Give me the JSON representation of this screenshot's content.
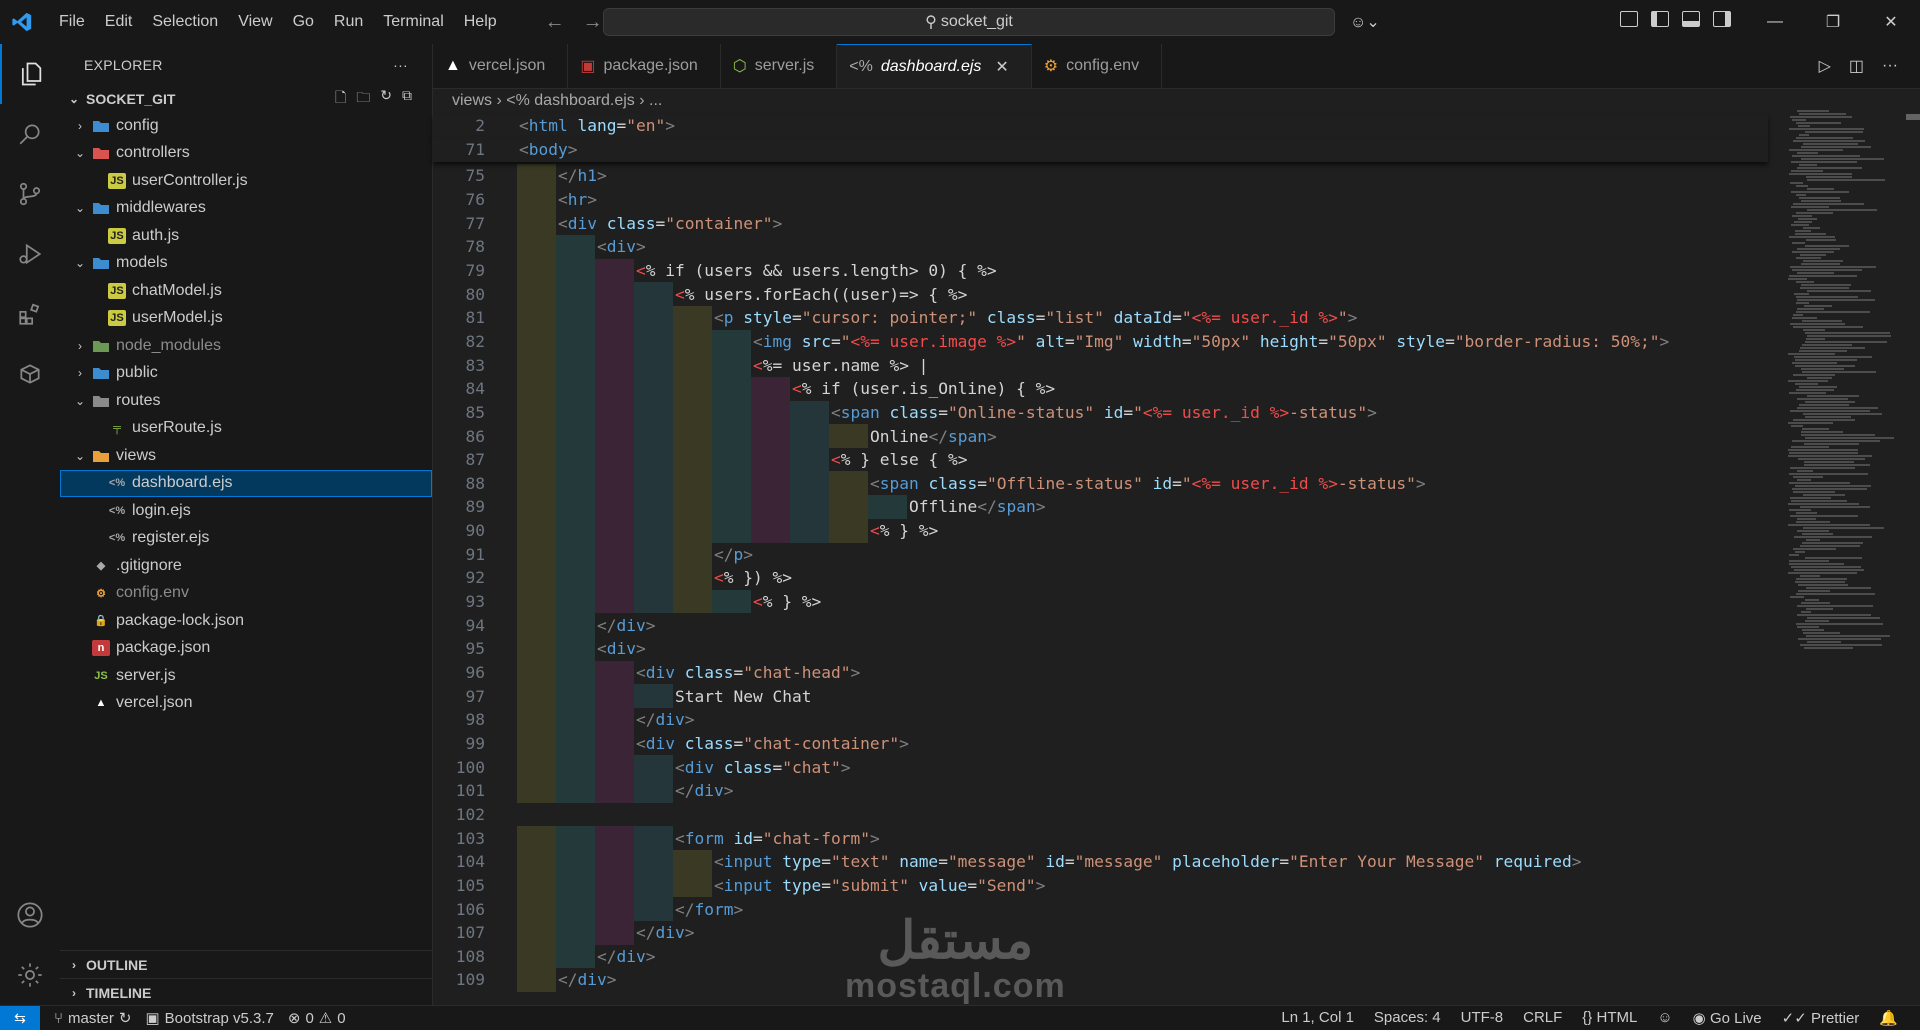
{
  "titlebar": {
    "menu": [
      "File",
      "Edit",
      "Selection",
      "View",
      "Go",
      "Run",
      "Terminal",
      "Help"
    ],
    "search_text": "socket_git"
  },
  "sidebar": {
    "title": "EXPLORER",
    "folder": "SOCKET_GIT",
    "tree": [
      {
        "label": "config",
        "kind": "folder",
        "depth": 1,
        "open": false
      },
      {
        "label": "controllers",
        "kind": "folder",
        "depth": 1,
        "open": true
      },
      {
        "label": "userController.js",
        "kind": "js",
        "depth": 2
      },
      {
        "label": "middlewares",
        "kind": "folder",
        "depth": 1,
        "open": true
      },
      {
        "label": "auth.js",
        "kind": "js",
        "depth": 2
      },
      {
        "label": "models",
        "kind": "folder",
        "depth": 1,
        "open": true
      },
      {
        "label": "chatModel.js",
        "kind": "js",
        "depth": 2
      },
      {
        "label": "userModel.js",
        "kind": "js",
        "depth": 2
      },
      {
        "label": "node_modules",
        "kind": "folder",
        "depth": 1,
        "open": false,
        "dim": true
      },
      {
        "label": "public",
        "kind": "folder",
        "depth": 1,
        "open": false
      },
      {
        "label": "routes",
        "kind": "folder",
        "depth": 1,
        "open": true
      },
      {
        "label": "userRoute.js",
        "kind": "route",
        "depth": 2
      },
      {
        "label": "views",
        "kind": "folder",
        "depth": 1,
        "open": true
      },
      {
        "label": "dashboard.ejs",
        "kind": "ejs",
        "depth": 2,
        "selected": true
      },
      {
        "label": "login.ejs",
        "kind": "ejs",
        "depth": 2
      },
      {
        "label": "register.ejs",
        "kind": "ejs",
        "depth": 2
      },
      {
        "label": ".gitignore",
        "kind": "git",
        "depth": 1
      },
      {
        "label": "config.env",
        "kind": "env",
        "depth": 1,
        "dim": true
      },
      {
        "label": "package-lock.json",
        "kind": "lock",
        "depth": 1
      },
      {
        "label": "package.json",
        "kind": "npm",
        "depth": 1
      },
      {
        "label": "server.js",
        "kind": "node",
        "depth": 1
      },
      {
        "label": "vercel.json",
        "kind": "vercel",
        "depth": 1
      }
    ],
    "outline": "OUTLINE",
    "timeline": "TIMELINE"
  },
  "tabs": [
    {
      "label": "vercel.json",
      "icon": "vercel-icon"
    },
    {
      "label": "package.json",
      "icon": "npm-icon"
    },
    {
      "label": "server.js",
      "icon": "node-icon"
    },
    {
      "label": "dashboard.ejs",
      "icon": "ejs-icon",
      "active": true
    },
    {
      "label": "config.env",
      "icon": "env-icon"
    }
  ],
  "breadcrumb": {
    "folder": "views",
    "file": "dashboard.ejs",
    "more": "..."
  },
  "code": {
    "sticky": [
      {
        "n": "2",
        "segs": [
          [
            "t",
            "<"
          ],
          [
            "tg",
            "html"
          ],
          [
            "at",
            " lang"
          ],
          [
            "d",
            "="
          ],
          [
            "sv",
            "\"en\""
          ],
          [
            "t",
            ">"
          ]
        ]
      },
      {
        "n": "71",
        "segs": [
          [
            "t",
            "<"
          ],
          [
            "tg",
            "body"
          ],
          [
            "t",
            ">"
          ]
        ]
      }
    ],
    "lines": [
      {
        "n": "75",
        "indent": 1,
        "segs": [
          [
            "t",
            "</"
          ],
          [
            "tg",
            "h1"
          ],
          [
            "t",
            ">"
          ]
        ]
      },
      {
        "n": "76",
        "indent": 1,
        "segs": [
          [
            "t",
            "<"
          ],
          [
            "tg",
            "hr"
          ],
          [
            "t",
            ">"
          ]
        ]
      },
      {
        "n": "77",
        "indent": 1,
        "segs": [
          [
            "t",
            "<"
          ],
          [
            "tg",
            "div"
          ],
          [
            "at",
            " class"
          ],
          [
            "d",
            "="
          ],
          [
            "sv",
            "\"container\""
          ],
          [
            "t",
            ">"
          ]
        ]
      },
      {
        "n": "78",
        "indent": 2,
        "segs": [
          [
            "t",
            "<"
          ],
          [
            "tg",
            "div"
          ],
          [
            "t",
            ">"
          ]
        ]
      },
      {
        "n": "79",
        "indent": 3,
        "segs": [
          [
            "ej",
            "<"
          ],
          [
            "d",
            "% if (users && users.length> 0) { %>"
          ]
        ]
      },
      {
        "n": "80",
        "indent": 4,
        "segs": [
          [
            "ej",
            "<"
          ],
          [
            "d",
            "% users.forEach((user)=> { %>"
          ]
        ]
      },
      {
        "n": "81",
        "indent": 5,
        "segs": [
          [
            "t",
            "<"
          ],
          [
            "tg",
            "p"
          ],
          [
            "at",
            " style"
          ],
          [
            "d",
            "="
          ],
          [
            "sv",
            "\"cursor: pointer;\""
          ],
          [
            "at",
            " class"
          ],
          [
            "d",
            "="
          ],
          [
            "sv",
            "\"list\""
          ],
          [
            "at",
            " dataId"
          ],
          [
            "d",
            "="
          ],
          [
            "sv",
            "\""
          ],
          [
            "ej",
            "<%= user._id %>"
          ],
          [
            "sv",
            "\""
          ],
          [
            "t",
            ">"
          ]
        ]
      },
      {
        "n": "82",
        "indent": 6,
        "segs": [
          [
            "t",
            "<"
          ],
          [
            "tg",
            "img"
          ],
          [
            "at",
            " src"
          ],
          [
            "d",
            "="
          ],
          [
            "sv",
            "\""
          ],
          [
            "ej",
            "<%= user.image %>"
          ],
          [
            "sv",
            "\""
          ],
          [
            "at",
            " alt"
          ],
          [
            "d",
            "="
          ],
          [
            "sv",
            "\"Img\""
          ],
          [
            "at",
            " width"
          ],
          [
            "d",
            "="
          ],
          [
            "sv",
            "\"50px\""
          ],
          [
            "at",
            " height"
          ],
          [
            "d",
            "="
          ],
          [
            "sv",
            "\"50px\""
          ],
          [
            "at",
            " style"
          ],
          [
            "d",
            "="
          ],
          [
            "sv",
            "\"border-radius: 50%;\""
          ],
          [
            "t",
            ">"
          ]
        ]
      },
      {
        "n": "83",
        "indent": 6,
        "segs": [
          [
            "ej",
            "<"
          ],
          [
            "d",
            "%= user.name %> |"
          ]
        ]
      },
      {
        "n": "84",
        "indent": 7,
        "segs": [
          [
            "ej",
            "<"
          ],
          [
            "d",
            "% if (user.is_Online) { %>"
          ]
        ]
      },
      {
        "n": "85",
        "indent": 8,
        "segs": [
          [
            "t",
            "<"
          ],
          [
            "tg",
            "span"
          ],
          [
            "at",
            " class"
          ],
          [
            "d",
            "="
          ],
          [
            "sv",
            "\"Online-status\""
          ],
          [
            "at",
            " id"
          ],
          [
            "d",
            "="
          ],
          [
            "sv",
            "\""
          ],
          [
            "ej",
            "<%= user._id %>"
          ],
          [
            "sv",
            "-status\""
          ],
          [
            "t",
            ">"
          ]
        ]
      },
      {
        "n": "86",
        "indent": 9,
        "segs": [
          [
            "d",
            "Online"
          ],
          [
            "t",
            "</"
          ],
          [
            "tg",
            "span"
          ],
          [
            "t",
            ">"
          ]
        ]
      },
      {
        "n": "87",
        "indent": 8,
        "segs": [
          [
            "ej",
            "<"
          ],
          [
            "d",
            "% } else { %>"
          ]
        ]
      },
      {
        "n": "88",
        "indent": 9,
        "segs": [
          [
            "t",
            "<"
          ],
          [
            "tg",
            "span"
          ],
          [
            "at",
            " class"
          ],
          [
            "d",
            "="
          ],
          [
            "sv",
            "\"Offline-status\""
          ],
          [
            "at",
            " id"
          ],
          [
            "d",
            "="
          ],
          [
            "sv",
            "\""
          ],
          [
            "ej",
            "<%= user._id %>"
          ],
          [
            "sv",
            "-status\""
          ],
          [
            "t",
            ">"
          ]
        ]
      },
      {
        "n": "89",
        "indent": 10,
        "segs": [
          [
            "d",
            "Offline"
          ],
          [
            "t",
            "</"
          ],
          [
            "tg",
            "span"
          ],
          [
            "t",
            ">"
          ]
        ]
      },
      {
        "n": "90",
        "indent": 9,
        "segs": [
          [
            "ej",
            "<"
          ],
          [
            "d",
            "% } %>"
          ]
        ]
      },
      {
        "n": "91",
        "indent": 5,
        "segs": [
          [
            "t",
            "</"
          ],
          [
            "tg",
            "p"
          ],
          [
            "t",
            ">"
          ]
        ]
      },
      {
        "n": "92",
        "indent": 5,
        "segs": [
          [
            "ej",
            "<"
          ],
          [
            "d",
            "% }) %>"
          ]
        ]
      },
      {
        "n": "93",
        "indent": 6,
        "segs": [
          [
            "ej",
            "<"
          ],
          [
            "d",
            "% } %>"
          ]
        ]
      },
      {
        "n": "94",
        "indent": 2,
        "segs": [
          [
            "t",
            "</"
          ],
          [
            "tg",
            "div"
          ],
          [
            "t",
            ">"
          ]
        ]
      },
      {
        "n": "95",
        "indent": 2,
        "segs": [
          [
            "t",
            "<"
          ],
          [
            "tg",
            "div"
          ],
          [
            "t",
            ">"
          ]
        ]
      },
      {
        "n": "96",
        "indent": 3,
        "segs": [
          [
            "t",
            "<"
          ],
          [
            "tg",
            "div"
          ],
          [
            "at",
            " class"
          ],
          [
            "d",
            "="
          ],
          [
            "sv",
            "\"chat-head\""
          ],
          [
            "t",
            ">"
          ]
        ]
      },
      {
        "n": "97",
        "indent": 4,
        "segs": [
          [
            "d",
            "Start New Chat"
          ]
        ]
      },
      {
        "n": "98",
        "indent": 3,
        "segs": [
          [
            "t",
            "</"
          ],
          [
            "tg",
            "div"
          ],
          [
            "t",
            ">"
          ]
        ]
      },
      {
        "n": "99",
        "indent": 3,
        "segs": [
          [
            "t",
            "<"
          ],
          [
            "tg",
            "div"
          ],
          [
            "at",
            " class"
          ],
          [
            "d",
            "="
          ],
          [
            "sv",
            "\"chat-container\""
          ],
          [
            "t",
            ">"
          ]
        ]
      },
      {
        "n": "100",
        "indent": 4,
        "segs": [
          [
            "t",
            "<"
          ],
          [
            "tg",
            "div"
          ],
          [
            "at",
            " class"
          ],
          [
            "d",
            "="
          ],
          [
            "sv",
            "\"chat\""
          ],
          [
            "t",
            ">"
          ]
        ]
      },
      {
        "n": "101",
        "indent": 4,
        "segs": [
          [
            "t",
            "</"
          ],
          [
            "tg",
            "div"
          ],
          [
            "t",
            ">"
          ]
        ]
      },
      {
        "n": "102",
        "indent": 0,
        "segs": []
      },
      {
        "n": "103",
        "indent": 4,
        "segs": [
          [
            "t",
            "<"
          ],
          [
            "tg",
            "form"
          ],
          [
            "at",
            " id"
          ],
          [
            "d",
            "="
          ],
          [
            "sv",
            "\"chat-form\""
          ],
          [
            "t",
            ">"
          ]
        ]
      },
      {
        "n": "104",
        "indent": 5,
        "segs": [
          [
            "t",
            "<"
          ],
          [
            "tg",
            "input"
          ],
          [
            "at",
            " type"
          ],
          [
            "d",
            "="
          ],
          [
            "sv",
            "\"text\""
          ],
          [
            "at",
            " name"
          ],
          [
            "d",
            "="
          ],
          [
            "sv",
            "\"message\""
          ],
          [
            "at",
            " id"
          ],
          [
            "d",
            "="
          ],
          [
            "sv",
            "\"message\""
          ],
          [
            "at",
            " placeholder"
          ],
          [
            "d",
            "="
          ],
          [
            "sv",
            "\"Enter Your Message\""
          ],
          [
            "at",
            " required"
          ],
          [
            "t",
            ">"
          ]
        ]
      },
      {
        "n": "105",
        "indent": 5,
        "segs": [
          [
            "t",
            "<"
          ],
          [
            "tg",
            "input"
          ],
          [
            "at",
            " type"
          ],
          [
            "d",
            "="
          ],
          [
            "sv",
            "\"submit\""
          ],
          [
            "at",
            " value"
          ],
          [
            "d",
            "="
          ],
          [
            "sv",
            "\"Send\""
          ],
          [
            "t",
            ">"
          ]
        ]
      },
      {
        "n": "106",
        "indent": 4,
        "segs": [
          [
            "t",
            "</"
          ],
          [
            "tg",
            "form"
          ],
          [
            "t",
            ">"
          ]
        ]
      },
      {
        "n": "107",
        "indent": 3,
        "segs": [
          [
            "t",
            "</"
          ],
          [
            "tg",
            "div"
          ],
          [
            "t",
            ">"
          ]
        ]
      },
      {
        "n": "108",
        "indent": 2,
        "segs": [
          [
            "t",
            "</"
          ],
          [
            "tg",
            "div"
          ],
          [
            "t",
            ">"
          ]
        ]
      },
      {
        "n": "109",
        "indent": 1,
        "segs": [
          [
            "t",
            "</"
          ],
          [
            "tg",
            "div"
          ],
          [
            "t",
            ">"
          ]
        ]
      }
    ]
  },
  "watermark": {
    "arabic": "مستقل",
    "latin": "mostaql.com"
  },
  "statusbar": {
    "branch": "master",
    "bootstrap": "Bootstrap v5.3.7",
    "errors": "0",
    "warnings": "0",
    "position": "Ln 1, Col 1",
    "spaces": "Spaces: 4",
    "encoding": "UTF-8",
    "eol": "CRLF",
    "language": "HTML",
    "golive": "Go Live",
    "prettier": "Prettier"
  },
  "colors": {
    "accent": "#0078d4",
    "tag": "#569cd6",
    "attr": "#9cdcfe",
    "string": "#ce9178",
    "ejs": "#f14c4c"
  }
}
